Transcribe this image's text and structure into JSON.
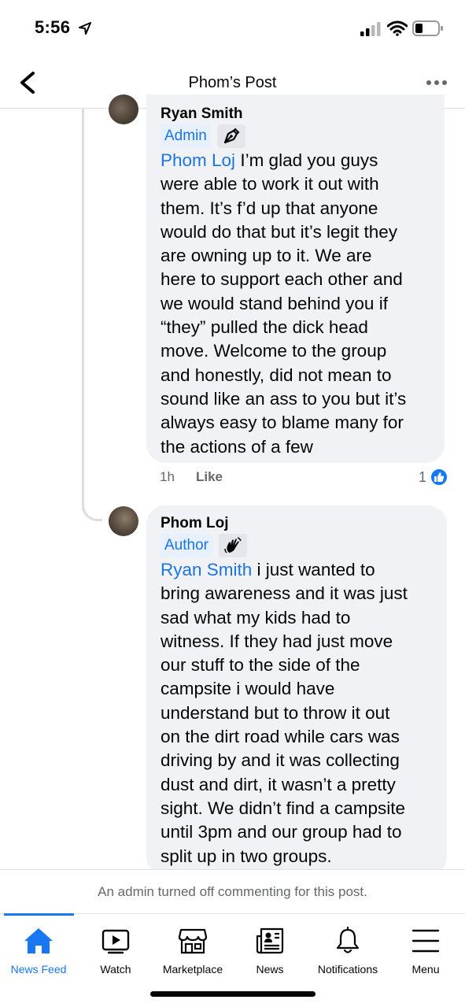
{
  "status_bar": {
    "time": "5:56"
  },
  "header": {
    "title": "Phom’s Post"
  },
  "comments": [
    {
      "author": "Ryan Smith",
      "role": "Admin",
      "badge_icon": "pen-nib-icon",
      "mention": "Phom Loj",
      "text": " I’m glad you guys\nwere able to work it out with\nthem.  It’s f’d up that anyone\nwould do that but it’s legit they\nare owning up to it.  We are\nhere to support each other and\nwe would stand behind you if\n“they” pulled the dick head\nmove.  Welcome to the group\nand honestly, did not mean to\nsound like an ass to you but it’s\nalways easy to blame many for\nthe actions of a few",
      "time": "1h",
      "like_label": "Like",
      "reaction_count": "1"
    },
    {
      "author": "Phom Loj",
      "role": "Author",
      "badge_icon": "waving-hand-icon",
      "mention": "Ryan Smith",
      "text": " i just wanted to\nbring awareness and it was just\nsad what my kids had to\nwitness. If they had just move\nour stuff to the side of the\ncampsite i would have\nunderstand but to throw it out\non the dirt road while cars was\ndriving by and it was collecting\ndust and dirt, it wasn’t a pretty\nsight. We didn’t find a campsite\nuntil 3pm and our group had to\nsplit up in two groups."
    }
  ],
  "notice": "An admin turned off commenting for this post.",
  "tabs": [
    {
      "label": "News Feed",
      "icon": "home-icon",
      "active": true
    },
    {
      "label": "Watch",
      "icon": "watch-icon"
    },
    {
      "label": "Marketplace",
      "icon": "marketplace-icon"
    },
    {
      "label": "News",
      "icon": "news-icon"
    },
    {
      "label": "Notifications",
      "icon": "bell-icon"
    },
    {
      "label": "Menu",
      "icon": "menu-icon"
    }
  ],
  "colors": {
    "accent": "#1877f2",
    "bubble": "#f0f2f5",
    "badge_bg": "#e7f0fd"
  }
}
